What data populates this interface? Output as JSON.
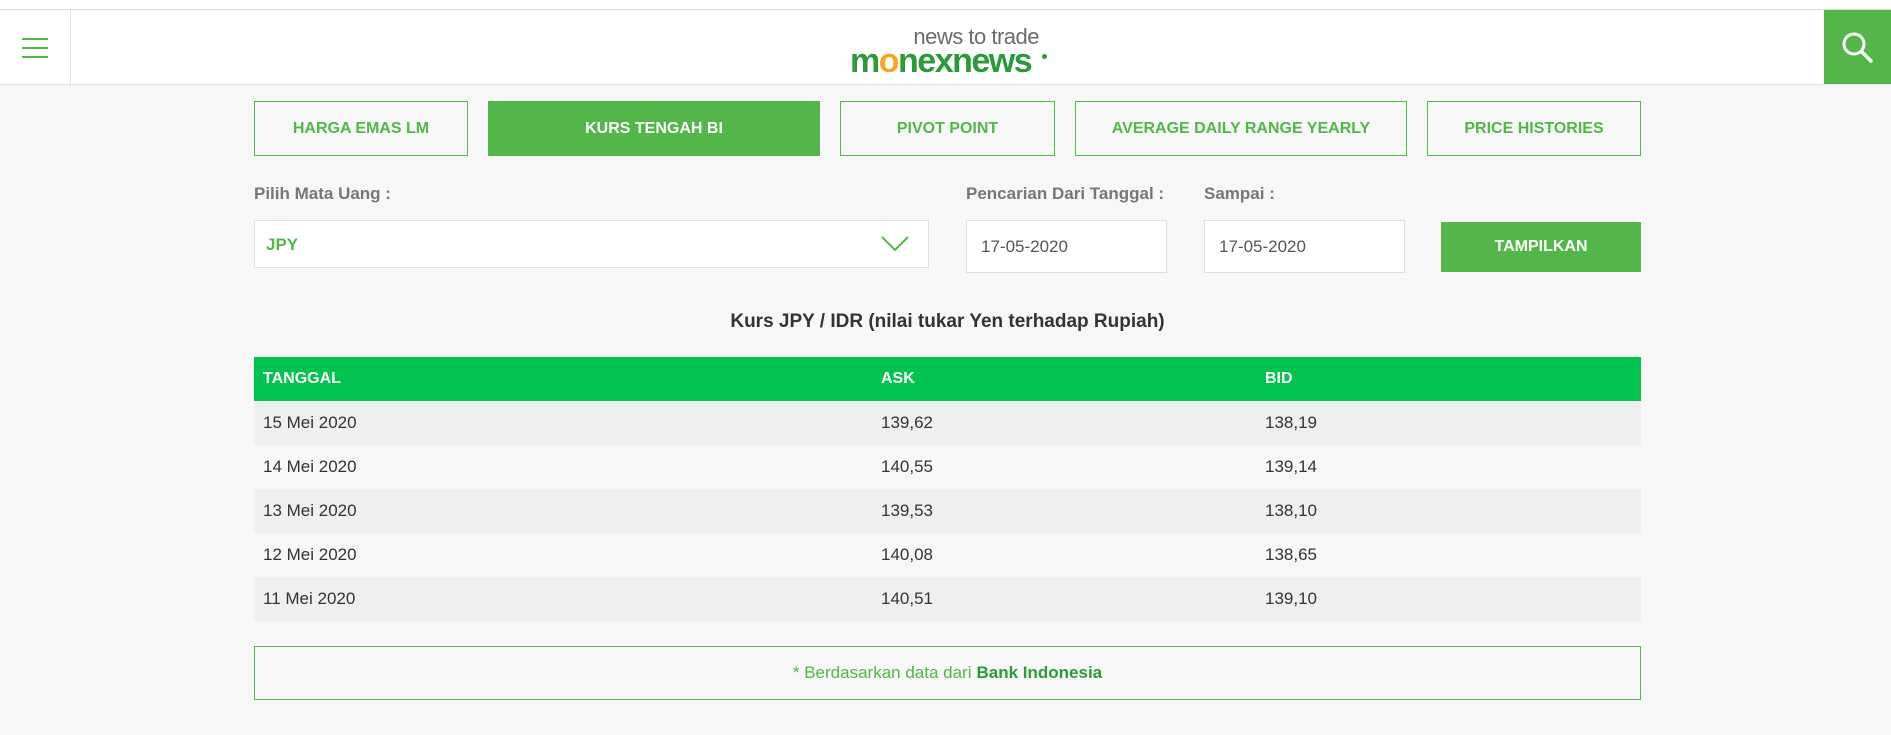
{
  "header": {
    "menu_icon": "hamburger-icon",
    "logo_tagline": "news to trade",
    "logo_brand_pre": "m",
    "logo_brand_o": "o",
    "logo_brand_post": "nexnews",
    "search_icon": "search-icon",
    "accent_color": "#52b748"
  },
  "tabs": [
    {
      "label": "HARGA EMAS LM",
      "active": false
    },
    {
      "label": "KURS TENGAH BI",
      "active": true
    },
    {
      "label": "PIVOT POINT",
      "active": false
    },
    {
      "label": "AVERAGE DAILY RANGE YEARLY",
      "active": false
    },
    {
      "label": "PRICE HISTORIES",
      "active": false
    }
  ],
  "filters": {
    "currency_label": "Pilih Mata Uang :",
    "currency_value": "JPY",
    "from_label": "Pencarian Dari Tanggal :",
    "from_value": "17-05-2020",
    "to_label": "Sampai :",
    "to_value": "17-05-2020",
    "submit_label": "TAMPILKAN"
  },
  "table": {
    "caption": "Kurs JPY / IDR (nilai tukar Yen terhadap Rupiah)",
    "headers": [
      "TANGGAL",
      "ASK",
      "BID"
    ],
    "header_color": "#00c44e",
    "rows": [
      [
        "15 Mei 2020",
        "139,62",
        "138,19"
      ],
      [
        "14 Mei 2020",
        "140,55",
        "139,14"
      ],
      [
        "13 Mei 2020",
        "139,53",
        "138,10"
      ],
      [
        "12 Mei 2020",
        "140,08",
        "138,65"
      ],
      [
        "11 Mei 2020",
        "140,51",
        "139,10"
      ]
    ]
  },
  "note": {
    "prefix": "* Berdasarkan data dari",
    "source": "Bank Indonesia"
  }
}
